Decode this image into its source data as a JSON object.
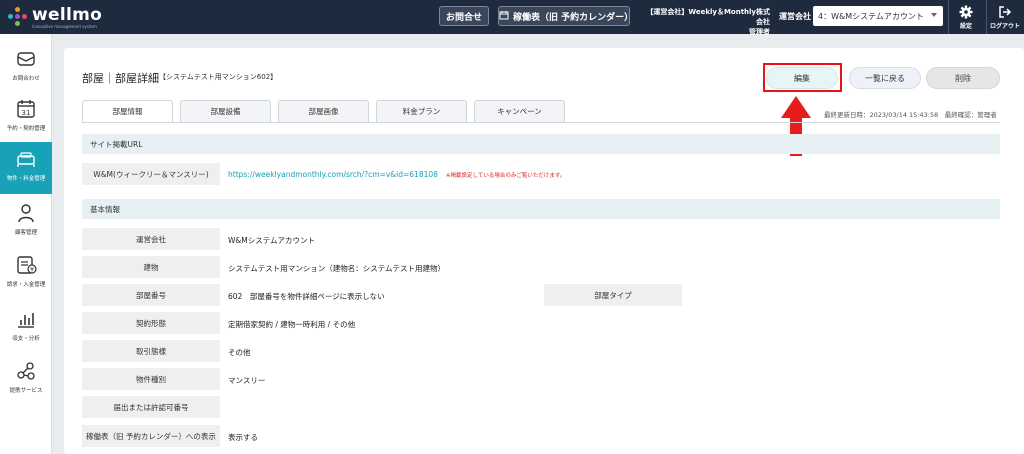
{
  "topbar": {
    "logo_text": "wellmo",
    "logo_sub": "innovative management system",
    "contact_label": "お問合せ",
    "calendar_label": "稼働表（旧 予約カレンダー）",
    "company_line1": "【運営会社】Weekly＆Monthly株式会社",
    "company_line2": "管理者",
    "operator_label": "運営会社",
    "operator_value": "4：W&Mシステムアカウント",
    "settings_label": "設定",
    "logout_label": "ログアウト"
  },
  "sidebar": {
    "items": [
      {
        "label": "お問合わせ",
        "icon": "mail-icon"
      },
      {
        "label": "予約・契約管理",
        "icon": "calendar-icon"
      },
      {
        "label": "物件・料金管理",
        "icon": "bed-icon",
        "active": true
      },
      {
        "label": "顧客管理",
        "icon": "person-icon"
      },
      {
        "label": "請求・入金管理",
        "icon": "invoice-icon"
      },
      {
        "label": "収支・分析",
        "icon": "bar-chart-icon"
      },
      {
        "label": "提携サービス",
        "icon": "network-icon"
      }
    ]
  },
  "page": {
    "title": "部屋｜部屋詳細",
    "subtitle": "【システムテスト用マンション602】",
    "edit_label": "編集",
    "back_label": "一覧に戻る",
    "delete_label": "削除",
    "updated": "最終更新日時：2023/03/14 15:43:58　最終確認：管理者"
  },
  "tabs": [
    "部屋情報",
    "部屋設備",
    "部屋画像",
    "料金プラン",
    "キャンペーン"
  ],
  "site_url": {
    "header": "サイト掲載URL",
    "label": "W&M(ウィークリー＆マンスリー)",
    "url": "https://weeklyandmonthly.com/srch/?cm=v&id=618108",
    "note": "※掲載設定している場合のみご覧いただけます。"
  },
  "basic_info": {
    "header": "基本情報",
    "rows": [
      {
        "label": "運営会社",
        "value": "W&Mシステムアカウント"
      },
      {
        "label": "建物",
        "value": "システムテスト用マンション（建物名：システムテスト用建物）"
      },
      {
        "label": "部屋番号",
        "value": "602　部屋番号を物件詳細ページに表示しない"
      },
      {
        "label": "契約形態",
        "value": "定期借家契約 / 建物一時利用 / その他"
      },
      {
        "label": "取引態様",
        "value": "その他"
      },
      {
        "label": "物件種別",
        "value": "マンスリー"
      },
      {
        "label": "届出または許認可番号",
        "value": ""
      },
      {
        "label": "稼働表（旧 予約カレンダー）への表示",
        "value": "表示する"
      }
    ],
    "room_type_label": "部屋タイプ"
  },
  "colors": {
    "topbar": "#1e2b3f",
    "accent": "#17a2b8",
    "highlight": "#e11111"
  }
}
